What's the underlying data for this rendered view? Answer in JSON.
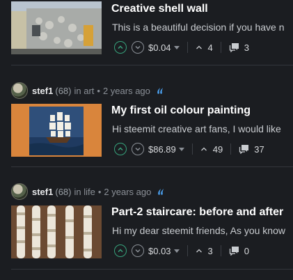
{
  "posts": [
    {
      "title": "Creative shell wall",
      "summary": "This is a beautiful decision if you have n",
      "payout": "$0.04",
      "votes": "4",
      "comments": "3"
    },
    {
      "author": "stef1",
      "reputation": "(68)",
      "category_prefix": "in art",
      "separator": "•",
      "time": "2 years ago",
      "title": "My first oil colour painting",
      "summary": "Hi steemit creative art fans, I would like",
      "payout": "$86.89",
      "votes": "49",
      "comments": "37"
    },
    {
      "author": "stef1",
      "reputation": "(68)",
      "category_prefix": "in life",
      "separator": "•",
      "time": "2 years ago",
      "title": "Part-2 staircare: before and after",
      "summary": "Hi my dear steemit friends, As you know",
      "payout": "$0.03",
      "votes": "3",
      "comments": "0"
    }
  ],
  "colors": {
    "background": "#1b1d21",
    "upvote": "#37a37c",
    "steem_logo": "#4ba2f2"
  }
}
